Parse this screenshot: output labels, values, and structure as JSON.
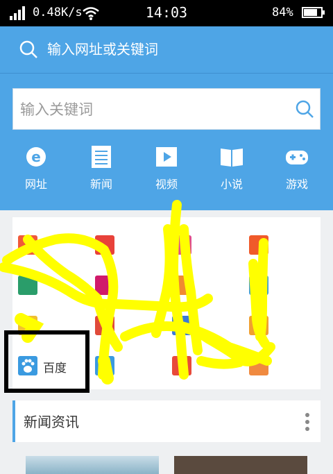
{
  "status_bar": {
    "net_speed": "0.48K/s",
    "time": "14:03",
    "battery": "84%"
  },
  "url_bar": {
    "placeholder": "输入网址或关键词"
  },
  "keyword_box": {
    "placeholder": "输入关键词"
  },
  "categories": [
    {
      "label": "网址",
      "icon": "ie-icon"
    },
    {
      "label": "新闻",
      "icon": "news-icon"
    },
    {
      "label": "视频",
      "icon": "video-icon"
    },
    {
      "label": "小说",
      "icon": "book-icon"
    },
    {
      "label": "游戏",
      "icon": "gamepad-icon"
    }
  ],
  "sites": {
    "highlighted_label": "百度"
  },
  "news_section": {
    "title": "新闻资讯"
  },
  "colors": {
    "header_blue": "#4ea5e6",
    "scribble_yellow": "#ffff00"
  }
}
